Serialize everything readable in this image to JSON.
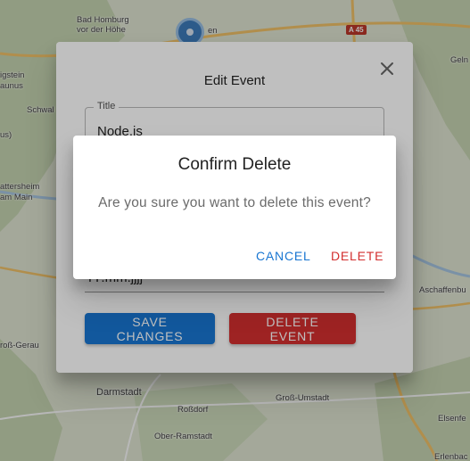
{
  "map": {
    "labels": {
      "bad_homburg": "Bad Homburg\nvor der Höhe",
      "en": "en",
      "gelnhausen": "Geln",
      "igstein": "igstein",
      "aunus": "aunus",
      "schwal": "Schwal",
      "us": "us)",
      "attersheim": "attersheim",
      "am_main": "am Main",
      "aschaffenburg": "Aschaffenbu",
      "gross_gerau": "roß-Gerau",
      "darmstadt": "Darmstadt",
      "rossdorf": "Roßdorf",
      "gross_umstadt": "Groß-Umstadt",
      "ober_ramstadt": "Ober-Ramstadt",
      "elsenfeld": "Elsenfe",
      "erlenbach": "Erlenbac"
    },
    "road_shield": "A 45",
    "colors": {
      "land": "#e3e9d6",
      "forest": "#c9d8b4",
      "road": "#f6c56a",
      "water": "#a9c9e6"
    }
  },
  "edit_dialog": {
    "title": "Edit Event",
    "close_icon": "close-icon",
    "title_field": {
      "label": "Title",
      "value": "Node.js"
    },
    "date_field": {
      "value": "ГГ.mm.jjjj"
    },
    "save_button": "SAVE CHANGES",
    "delete_button": "DELETE EVENT",
    "colors": {
      "primary": "#1976d2",
      "danger": "#d32f2f"
    }
  },
  "confirm_dialog": {
    "title": "Confirm Delete",
    "message": "Are you sure you want to delete this event?",
    "cancel_button": "CANCEL",
    "delete_button": "DELETE"
  }
}
